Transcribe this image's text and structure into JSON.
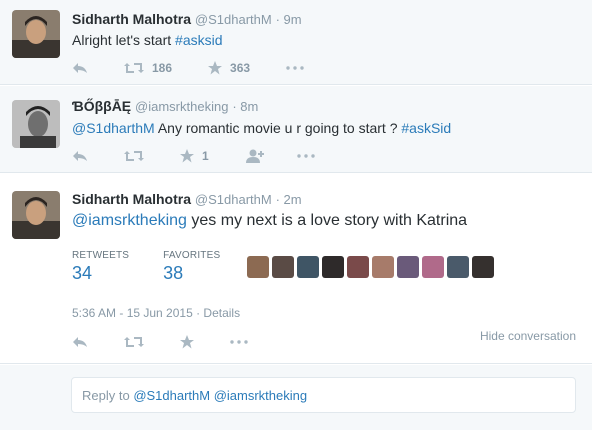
{
  "tweets": [
    {
      "name": "Sidharth Malhotra",
      "handle": "@S1dharthM",
      "time": "· 9m",
      "text": "Alright let's start ",
      "hashtag": "#asksid",
      "retweets": "186",
      "favorites": "363"
    },
    {
      "name": "ƁŐββĀĘ",
      "handle": "@iamsrktheking",
      "time": "· 8m",
      "mention": "@S1dharthM",
      "text": " Any romantic movie u r going to start ? ",
      "hashtag": "#askSid",
      "favorites": "1"
    },
    {
      "name": "Sidharth Malhotra",
      "handle": "@S1dharthM",
      "time": "· 2m",
      "mention": "@iamsrktheking",
      "text": " yes my next is a love story with Katrina",
      "retweets_label": "RETWEETS",
      "retweets": "34",
      "favorites_label": "FAVORITES",
      "favorites": "38",
      "timestamp": "5:36 AM - 15 Jun 2015",
      "details": " · Details",
      "hide_conversation": "Hide conversation"
    }
  ],
  "reply": {
    "prefix": "Reply to ",
    "mentions": "@S1dharthM @iamsrktheking"
  },
  "colors": {
    "link": "#2b7bb9",
    "muted": "#8899a6",
    "background_muted": "#f5f8fa"
  },
  "icons": [
    "reply-icon",
    "retweet-icon",
    "favorite-icon",
    "more-icon",
    "follow-icon"
  ]
}
